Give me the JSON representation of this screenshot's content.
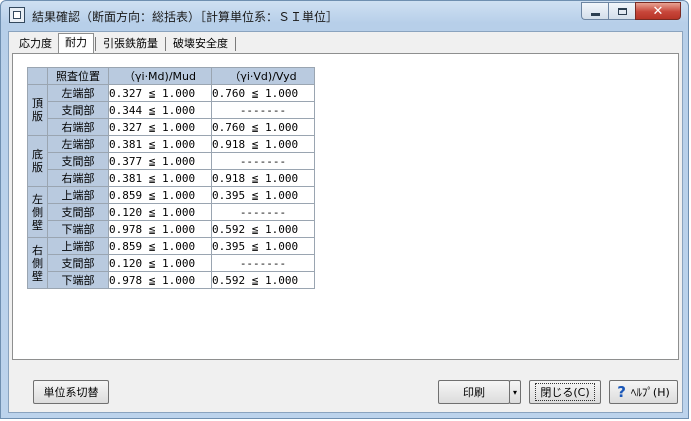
{
  "window": {
    "title": "結果確認（断面方向：総括表）［計算単位系：ＳＩ単位］",
    "close_glyph": "✕"
  },
  "tabs": [
    "応力度",
    "耐力",
    "引張鉄筋量",
    "破壊安全度"
  ],
  "active_tab": 1,
  "table": {
    "headers": {
      "position": "照査位置",
      "col1": "（γi·Md)/Mud",
      "col2": "（γi·Vd)/Vyd"
    },
    "groups": [
      {
        "label": "頂版",
        "rows": [
          {
            "pos": "左端部",
            "c1": "0.327 ≦ 1.000",
            "c2": "0.760 ≦ 1.000"
          },
          {
            "pos": "支間部",
            "c1": "0.344 ≦ 1.000",
            "c2": "-------"
          },
          {
            "pos": "右端部",
            "c1": "0.327 ≦ 1.000",
            "c2": "0.760 ≦ 1.000"
          }
        ]
      },
      {
        "label": "底版",
        "rows": [
          {
            "pos": "左端部",
            "c1": "0.381 ≦ 1.000",
            "c2": "0.918 ≦ 1.000"
          },
          {
            "pos": "支間部",
            "c1": "0.377 ≦ 1.000",
            "c2": "-------"
          },
          {
            "pos": "右端部",
            "c1": "0.381 ≦ 1.000",
            "c2": "0.918 ≦ 1.000"
          }
        ]
      },
      {
        "label": "左側壁",
        "rows": [
          {
            "pos": "上端部",
            "c1": "0.859 ≦ 1.000",
            "c2": "0.395 ≦ 1.000"
          },
          {
            "pos": "支間部",
            "c1": "0.120 ≦ 1.000",
            "c2": "-------"
          },
          {
            "pos": "下端部",
            "c1": "0.978 ≦ 1.000",
            "c2": "0.592 ≦ 1.000"
          }
        ]
      },
      {
        "label": "右側壁",
        "rows": [
          {
            "pos": "上端部",
            "c1": "0.859 ≦ 1.000",
            "c2": "0.395 ≦ 1.000"
          },
          {
            "pos": "支間部",
            "c1": "0.120 ≦ 1.000",
            "c2": "-------"
          },
          {
            "pos": "下端部",
            "c1": "0.978 ≦ 1.000",
            "c2": "0.592 ≦ 1.000"
          }
        ]
      }
    ]
  },
  "buttons": {
    "unit_toggle": "単位系切替",
    "print": "印刷",
    "print_dropdown": "▾",
    "close": "閉じる(C)",
    "help": "ﾍﾙﾌﾟ(H)",
    "help_icon_glyph": "?"
  }
}
